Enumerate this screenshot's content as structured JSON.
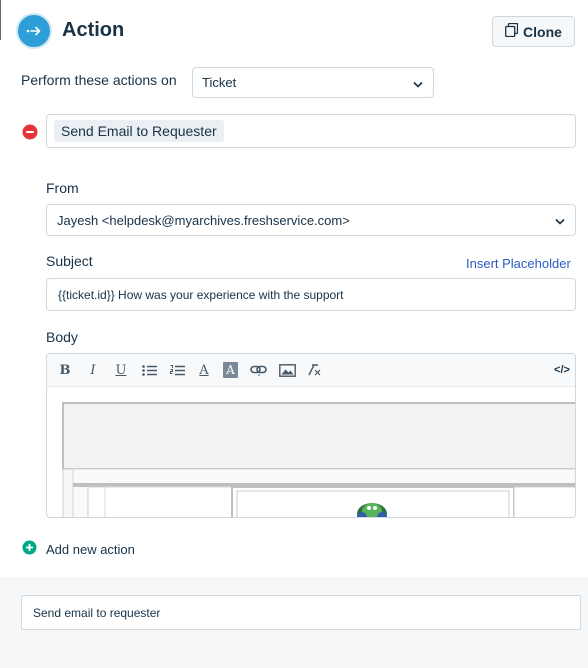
{
  "header": {
    "title": "Action",
    "clone_label": "Clone"
  },
  "perform": {
    "label": "Perform these actions on",
    "selected": "Ticket"
  },
  "action": {
    "name": "Send Email to Requester"
  },
  "from": {
    "label": "From",
    "value": "Jayesh <helpdesk@myarchives.freshservice.com>"
  },
  "subject": {
    "label": "Subject",
    "insert_placeholder": "Insert Placeholder",
    "value": "{{ticket.id}}  How was your experience with the support"
  },
  "body": {
    "label": "Body",
    "toolbar": {
      "bold": "B",
      "italic": "I",
      "underline": "U",
      "font_color": "A",
      "bg_color": "A",
      "source": "</>"
    }
  },
  "add_action": {
    "label": "Add new action"
  },
  "footer": {
    "name_value": "Send email to requester"
  },
  "colors": {
    "primary": "#2e9fd6",
    "remove": "#e43538",
    "add": "#00a886",
    "link": "#2c5cc5",
    "text": "#183247"
  }
}
